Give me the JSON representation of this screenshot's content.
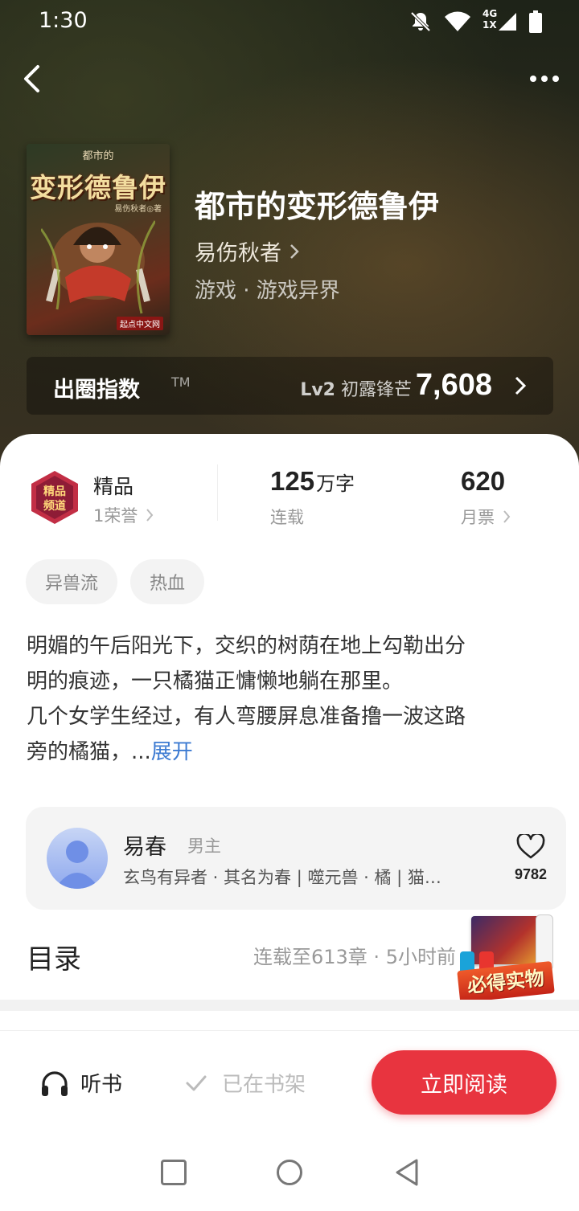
{
  "status": {
    "time": "1:30",
    "network": "4G",
    "sim": "1X"
  },
  "header": {
    "back_icon": "chevron-left-icon",
    "more_icon": "more-dots-icon"
  },
  "book": {
    "cover": {
      "top_text": "都市的",
      "title_text": "变形德鲁伊",
      "author_text": "易伤秋者◎著",
      "publisher_text": "起点中文网"
    },
    "title": "都市的变形德鲁伊",
    "author": "易伤秋者",
    "genre": "游戏 · 游戏异界"
  },
  "influence_index": {
    "label": "出圈指数",
    "trademark": "TM",
    "level_code": "Lv2",
    "level_name": "初露锋芒",
    "value": "7,608"
  },
  "stats": {
    "quality": {
      "title": "精品",
      "honors": "1荣誉"
    },
    "words": {
      "number": "125",
      "unit": "万字",
      "status": "连载"
    },
    "votes": {
      "number": "620",
      "label": "月票"
    }
  },
  "tags": [
    "异兽流",
    "热血"
  ],
  "synopsis": {
    "lines": [
      "明媚的午后阳光下，交织的树荫在地上勾勒出分",
      "明的痕迹，一只橘猫正慵懒地躺在那里。",
      "几个女学生经过，有人弯腰屏息准备撸一波这路",
      "旁的橘猫，..."
    ],
    "expand_label": "展开"
  },
  "character": {
    "name": "易春",
    "role": "男主",
    "description": "玄鸟有异者 · 其名为春 | 噬元兽 · 橘 | 猫…",
    "likes": "9782"
  },
  "toc": {
    "title": "目录",
    "info": "连载至613章 · 5小时前"
  },
  "promo": {
    "label": "必得实物"
  },
  "actions": {
    "listen": "听书",
    "shelf": "已在书架",
    "read": "立即阅读"
  },
  "colors": {
    "accent": "#e8343f",
    "link": "#3d7bd2",
    "hero_bg": "#2a2a1d"
  }
}
